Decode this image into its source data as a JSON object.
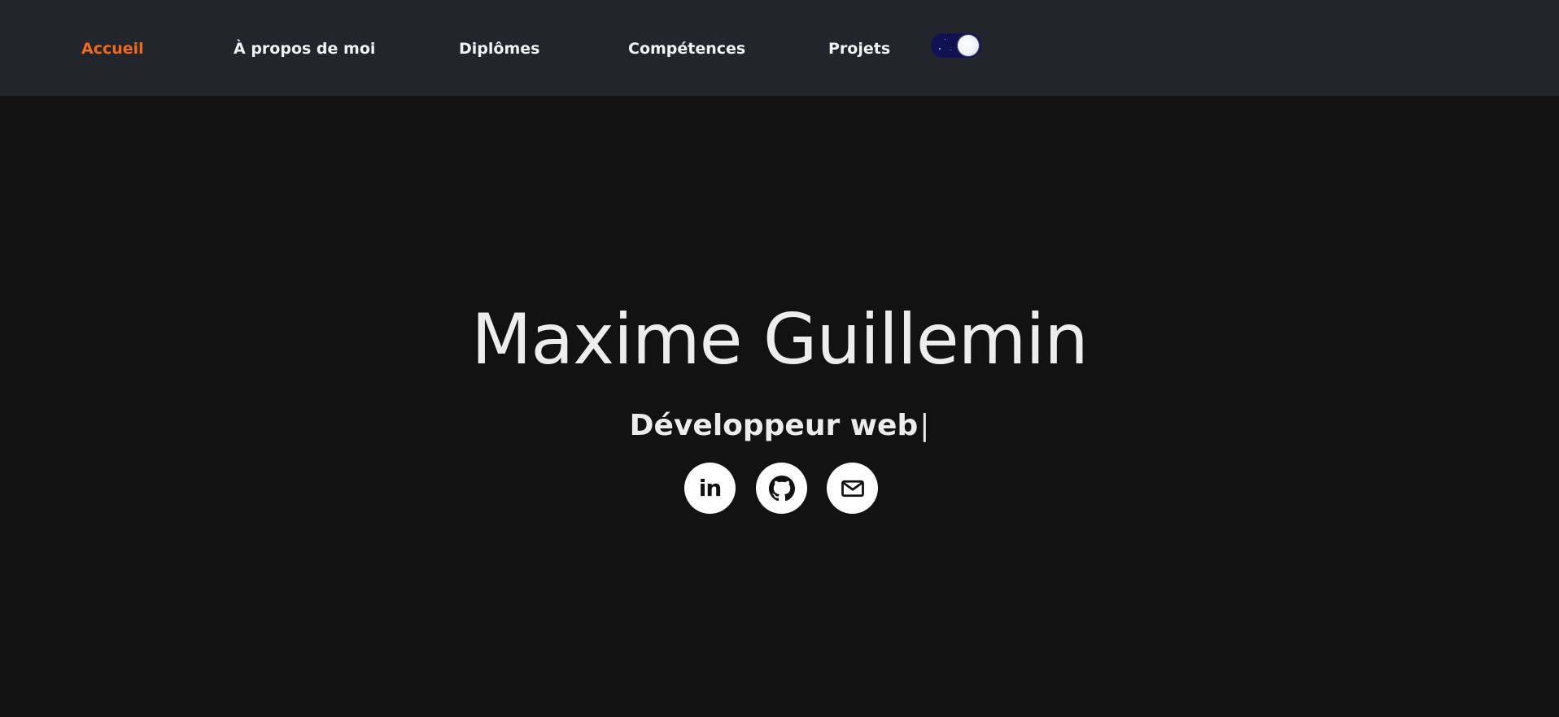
{
  "nav": {
    "links": [
      {
        "label": "Accueil",
        "active": true
      },
      {
        "label": "À propos de moi",
        "active": false
      },
      {
        "label": "Diplômes",
        "active": false
      },
      {
        "label": "Compétences",
        "active": false
      },
      {
        "label": "Projets",
        "active": false
      }
    ],
    "theme_toggle": {
      "state": "dark",
      "icon": "moon-icon"
    }
  },
  "hero": {
    "name": "Maxime Guillemin",
    "subtitle": "Développeur web",
    "cursor": "|"
  },
  "social": {
    "linkedin_label": "in",
    "items": [
      {
        "icon": "linkedin-icon"
      },
      {
        "icon": "github-icon"
      },
      {
        "icon": "mail-icon"
      }
    ]
  },
  "colors": {
    "accent": "#ef6a1c",
    "navbar_bg": "#22252c",
    "page_bg": "#121212",
    "text": "#ededed",
    "toggle_bg": "#0f1150"
  }
}
